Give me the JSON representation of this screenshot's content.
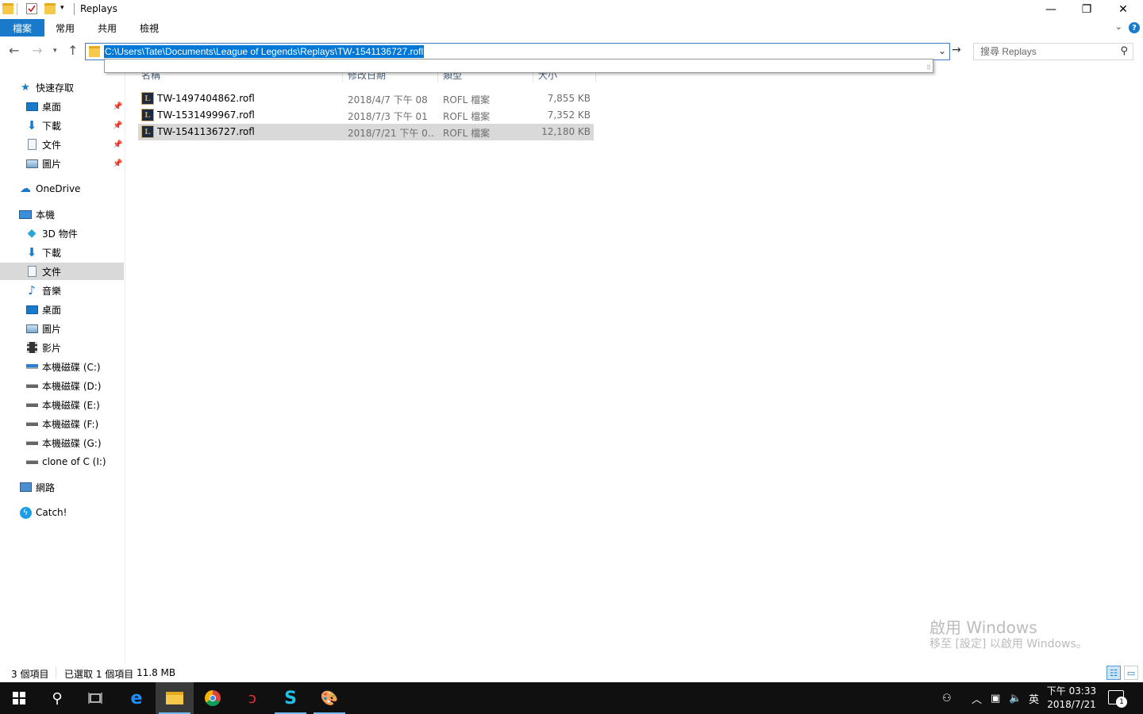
{
  "window": {
    "title": "Replays",
    "minimize_glyph": "—",
    "maximize_glyph": "❐",
    "close_glyph": "✕"
  },
  "ribbon": {
    "tabs": [
      {
        "label": "檔案"
      },
      {
        "label": "常用"
      },
      {
        "label": "共用"
      },
      {
        "label": "檢視"
      }
    ],
    "help_glyph": "?"
  },
  "address_bar": {
    "path": "C:\\Users\\Tate\\Documents\\League of Legends\\Replays\\TW-1541136727.rofl"
  },
  "search": {
    "placeholder": "搜尋 Replays"
  },
  "columns": [
    "名稱",
    "修改日期",
    "類型",
    "大小"
  ],
  "files": [
    {
      "name": "TW-1497404862.rofl",
      "date": "2018/4/7 下午 08",
      "type": "ROFL 檔案",
      "size": "7,855 KB",
      "selected": false
    },
    {
      "name": "TW-1531499967.rofl",
      "date": "2018/7/3 下午 01",
      "type": "ROFL 檔案",
      "size": "7,352 KB",
      "selected": false
    },
    {
      "name": "TW-1541136727.rofl",
      "date": "2018/7/21 下午 0...",
      "type": "ROFL 檔案",
      "size": "12,180 KB",
      "selected": true
    }
  ],
  "nav_pane": [
    {
      "label": "快速存取",
      "icon": "star-icon"
    },
    {
      "label": "桌面",
      "icon": "desktop-icon",
      "pinned": true
    },
    {
      "label": "下載",
      "icon": "download-icon",
      "pinned": true
    },
    {
      "label": "文件",
      "icon": "document-icon",
      "pinned": true
    },
    {
      "label": "圖片",
      "icon": "pictures-icon",
      "pinned": true
    },
    {
      "label": "OneDrive",
      "icon": "cloud-icon"
    },
    {
      "label": "本機",
      "icon": "computer-icon"
    },
    {
      "label": "3D 物件",
      "icon": "cube-icon"
    },
    {
      "label": "下載",
      "icon": "download-icon"
    },
    {
      "label": "文件",
      "icon": "document-icon",
      "selected": true
    },
    {
      "label": "音樂",
      "icon": "music-icon"
    },
    {
      "label": "桌面",
      "icon": "desktop-icon"
    },
    {
      "label": "圖片",
      "icon": "pictures-icon"
    },
    {
      "label": "影片",
      "icon": "video-icon"
    },
    {
      "label": "本機磁碟 (C:)",
      "icon": "drive-icon"
    },
    {
      "label": "本機磁碟 (D:)",
      "icon": "drive-icon"
    },
    {
      "label": "本機磁碟 (E:)",
      "icon": "drive-icon"
    },
    {
      "label": "本機磁碟 (F:)",
      "icon": "drive-icon"
    },
    {
      "label": "本機磁碟 (G:)",
      "icon": "drive-icon"
    },
    {
      "label": "clone of C (I:)",
      "icon": "drive-icon"
    },
    {
      "label": "網路",
      "icon": "network-icon"
    },
    {
      "label": "Catch!",
      "icon": "catch-icon"
    }
  ],
  "status": {
    "item_count": "3 個項目",
    "selected": "已選取 1 個項目",
    "size": "11.8 MB"
  },
  "watermark": {
    "line1": "啟用 Windows",
    "line2": "移至 [設定] 以啟用 Windows。"
  },
  "taskbar": {
    "ime": "英",
    "time": "下午 03:33",
    "date": "2018/7/21",
    "notification_count": "1"
  },
  "colors": {
    "accent": "#1979ca",
    "selection": "#d9d9d9",
    "taskbar": "#101010"
  }
}
